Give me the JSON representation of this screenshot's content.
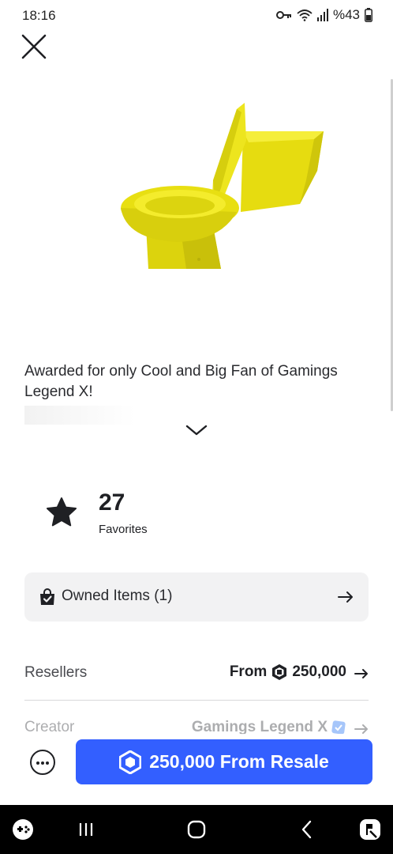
{
  "status_bar": {
    "time": "18:16",
    "battery": "%43",
    "icons": [
      "key-icon",
      "wifi-icon",
      "signal-icon",
      "battery-icon"
    ]
  },
  "header": {
    "close_icon": "close-icon"
  },
  "item": {
    "image_icon": "yellow-toilet-image",
    "description": "Awarded for only Cool and Big Fan of Gamings Legend X!"
  },
  "favorites": {
    "count": "27",
    "label": "Favorites"
  },
  "owned": {
    "label": "Owned Items (1)"
  },
  "resellers": {
    "label": "Resellers",
    "from_text": "From",
    "price": "250,000"
  },
  "creator": {
    "label": "Creator",
    "name": "Gamings Legend X"
  },
  "buy_button": {
    "label": "250,000 From Resale"
  },
  "colors": {
    "accent": "#335fff",
    "item_yellow": "#f2ea1a",
    "verified": "#3b82f6"
  },
  "nav_bar": {
    "icons": [
      "game-launcher-icon",
      "recents-icon",
      "home-icon",
      "back-icon",
      "assistant-icon"
    ]
  }
}
